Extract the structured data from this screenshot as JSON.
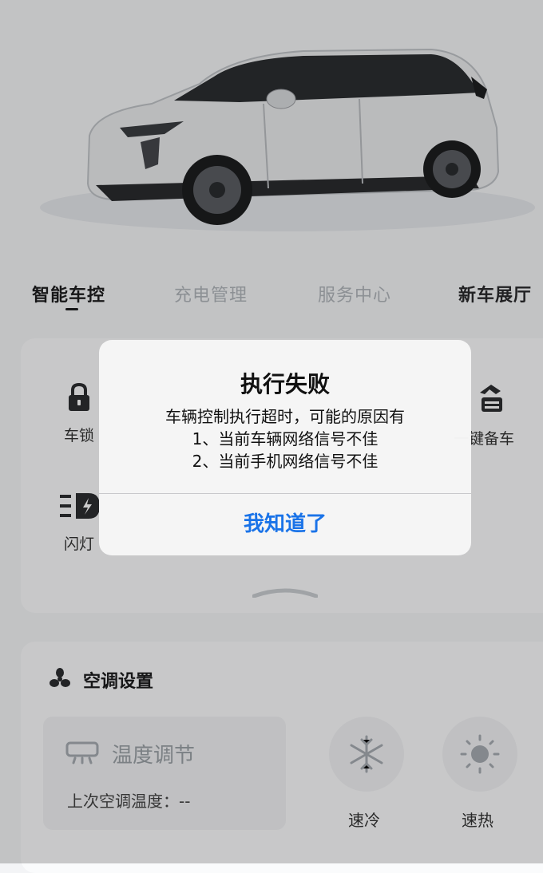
{
  "tabs": [
    {
      "label": "智能车控"
    },
    {
      "label": "充电管理"
    },
    {
      "label": "服务中心"
    },
    {
      "label": "新车展厅"
    }
  ],
  "controls": [
    {
      "label": "车锁",
      "icon": "lock-icon"
    },
    {
      "label": "一键备车",
      "icon": "prep-car-icon"
    },
    {
      "label": "闪灯",
      "icon": "flash-light-icon"
    }
  ],
  "ac": {
    "title": "空调设置",
    "temp_title": "温度调节",
    "last_temp": "上次空调温度：--",
    "cool_label": "速冷",
    "heat_label": "速热"
  },
  "dialog": {
    "title": "执行失败",
    "message_line1": "车辆控制执行超时，可能的原因有",
    "message_line2": "1、当前车辆网络信号不佳",
    "message_line3": "2、当前手机网络信号不佳",
    "button": "我知道了"
  },
  "colors": {
    "accent": "#1a73e8",
    "panel": "#fafbfc",
    "background": "#f3f4f6"
  }
}
